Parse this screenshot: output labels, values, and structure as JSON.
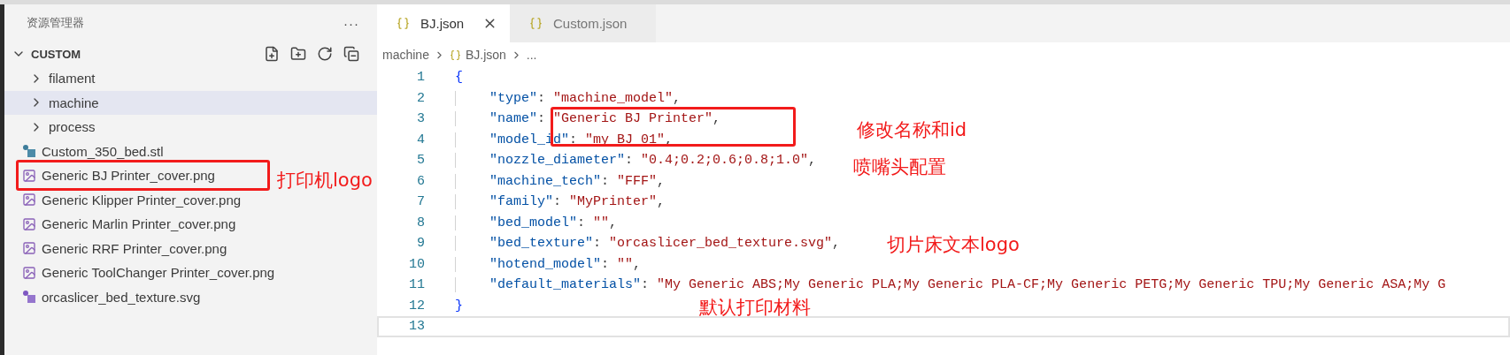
{
  "sidebar": {
    "title": "资源管理器",
    "more": "···",
    "folder": {
      "name": "CUSTOM",
      "expanded": true,
      "children": [
        {
          "name": "filament",
          "kind": "folder",
          "expanded": false,
          "selected": false
        },
        {
          "name": "machine",
          "kind": "folder",
          "expanded": false,
          "selected": true
        },
        {
          "name": "process",
          "kind": "folder",
          "expanded": false,
          "selected": false
        },
        {
          "name": "Custom_350_bed.stl",
          "kind": "model",
          "selected": false
        },
        {
          "name": "Generic BJ Printer_cover.png",
          "kind": "image",
          "selected": false
        },
        {
          "name": "Generic Klipper Printer_cover.png",
          "kind": "image",
          "selected": false
        },
        {
          "name": "Generic Marlin Printer_cover.png",
          "kind": "image",
          "selected": false
        },
        {
          "name": "Generic RRF Printer_cover.png",
          "kind": "image",
          "selected": false
        },
        {
          "name": "Generic ToolChanger Printer_cover.png",
          "kind": "image",
          "selected": false
        },
        {
          "name": "orcaslicer_bed_texture.svg",
          "kind": "vector",
          "selected": false
        }
      ]
    }
  },
  "tabs": [
    {
      "label": "BJ.json",
      "selected": true
    },
    {
      "label": "Custom.json",
      "selected": false
    }
  ],
  "breadcrumb": [
    {
      "label": "machine",
      "kind": "folder"
    },
    {
      "label": "BJ.json",
      "kind": "file"
    },
    {
      "label": "...",
      "kind": "more"
    }
  ],
  "code_lines": [
    {
      "number": "1",
      "current": false,
      "brace": "{"
    },
    {
      "number": "2",
      "current": false,
      "key": "\"type\"",
      "separator": ": ",
      "value": "\"machine_model\"",
      "trailing": ","
    },
    {
      "number": "3",
      "current": false,
      "key": "\"name\"",
      "separator": ": ",
      "value": "\"Generic BJ Printer\"",
      "trailing": ","
    },
    {
      "number": "4",
      "current": false,
      "key": "\"model_id\"",
      "separator": ": ",
      "value": "\"my BJ 01\"",
      "trailing": ","
    },
    {
      "number": "5",
      "current": false,
      "key": "\"nozzle_diameter\"",
      "separator": ": ",
      "value": "\"0.4;0.2;0.6;0.8;1.0\"",
      "trailing": ","
    },
    {
      "number": "6",
      "current": false,
      "key": "\"machine_tech\"",
      "separator": ": ",
      "value": "\"FFF\"",
      "trailing": ","
    },
    {
      "number": "7",
      "current": false,
      "key": "\"family\"",
      "separator": ": ",
      "value": "\"MyPrinter\"",
      "trailing": ","
    },
    {
      "number": "8",
      "current": false,
      "key": "\"bed_model\"",
      "separator": ": ",
      "value": "\"\"",
      "trailing": ","
    },
    {
      "number": "9",
      "current": false,
      "key": "\"bed_texture\"",
      "separator": ": ",
      "value": "\"orcaslicer_bed_texture.svg\"",
      "trailing": ","
    },
    {
      "number": "10",
      "current": false,
      "key": "\"hotend_model\"",
      "separator": ": ",
      "value": "\"\"",
      "trailing": ","
    },
    {
      "number": "11",
      "current": false,
      "key": "\"default_materials\"",
      "separator": ": ",
      "value": "\"My Generic ABS;My Generic PLA;My Generic PLA-CF;My Generic PETG;My Generic TPU;My Generic ASA;My G"
    },
    {
      "number": "12",
      "current": false,
      "brace": "}"
    },
    {
      "number": "13",
      "current": true
    }
  ],
  "annotations": [
    {
      "kind": "box"
    },
    {
      "kind": "label",
      "text": "打印机logo"
    },
    {
      "kind": "box"
    },
    {
      "kind": "label",
      "text": "修改名称和id"
    },
    {
      "kind": "label",
      "text": "喷嘴头配置"
    },
    {
      "kind": "label",
      "text": "切片床文本logo"
    },
    {
      "kind": "label",
      "text": "默认打印材料"
    }
  ]
}
